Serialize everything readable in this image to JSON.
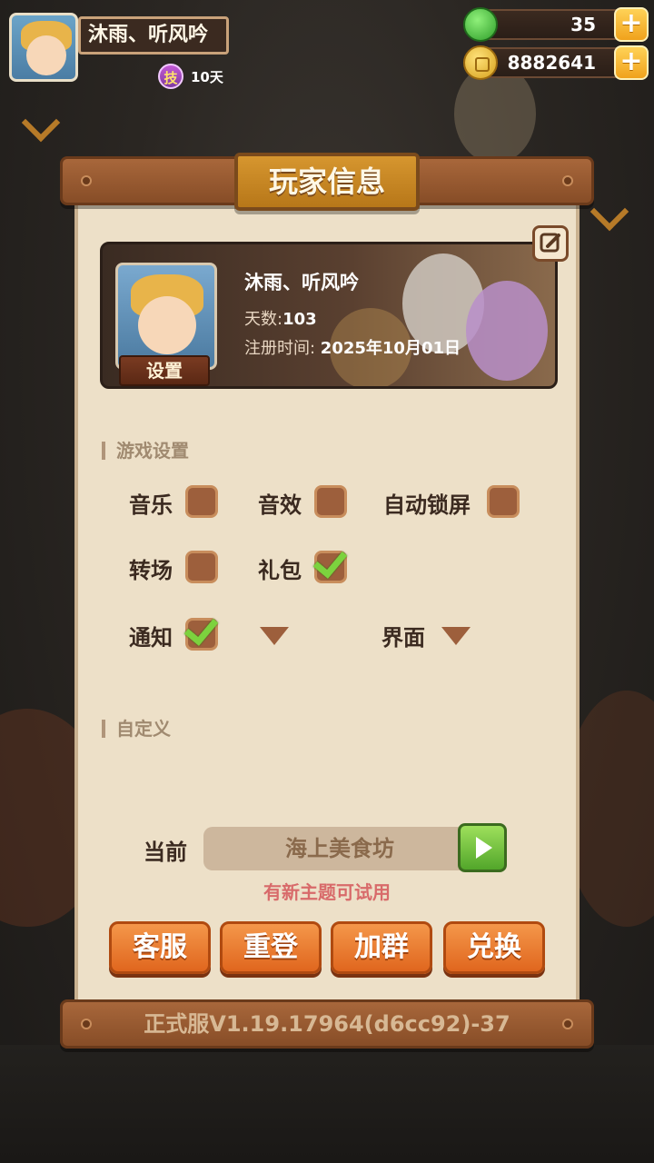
{
  "hud": {
    "player_name": "沐雨、听风吟",
    "skill_badge": "技",
    "skill_days": "10天",
    "energy": "35",
    "coins": "8882641",
    "plus_label": "+"
  },
  "panel": {
    "title": "玩家信息",
    "version": "正式服V1.19.17964(d6cc92)-37"
  },
  "player_card": {
    "name": "沐雨、听风吟",
    "days_label": "天数:",
    "days_value": "103",
    "reg_label": "注册时间: ",
    "reg_value": "2025年10月01日",
    "settings_label": "设置"
  },
  "game_settings": {
    "header": "游戏设置",
    "music": {
      "label": "音乐",
      "checked": false
    },
    "sound": {
      "label": "音效",
      "checked": false
    },
    "auto_lock": {
      "label": "自动锁屏",
      "checked": false
    },
    "transition": {
      "label": "转场",
      "checked": false
    },
    "gift": {
      "label": "礼包",
      "checked": true
    },
    "notify": {
      "label": "通知",
      "checked": true
    },
    "interface": {
      "label": "界面"
    }
  },
  "custom": {
    "header": "自定义",
    "current_label": "当前",
    "theme_name": "海上美食坊",
    "theme_note": "有新主题可试用"
  },
  "actions": {
    "service": "客服",
    "relogin": "重登",
    "join_group": "加群",
    "redeem": "兑换"
  },
  "colors": {
    "panel_wood": "#a8673b",
    "paper": "#ede0c8",
    "accent_orange": "#e0661e",
    "check_green": "#7cd23e"
  }
}
